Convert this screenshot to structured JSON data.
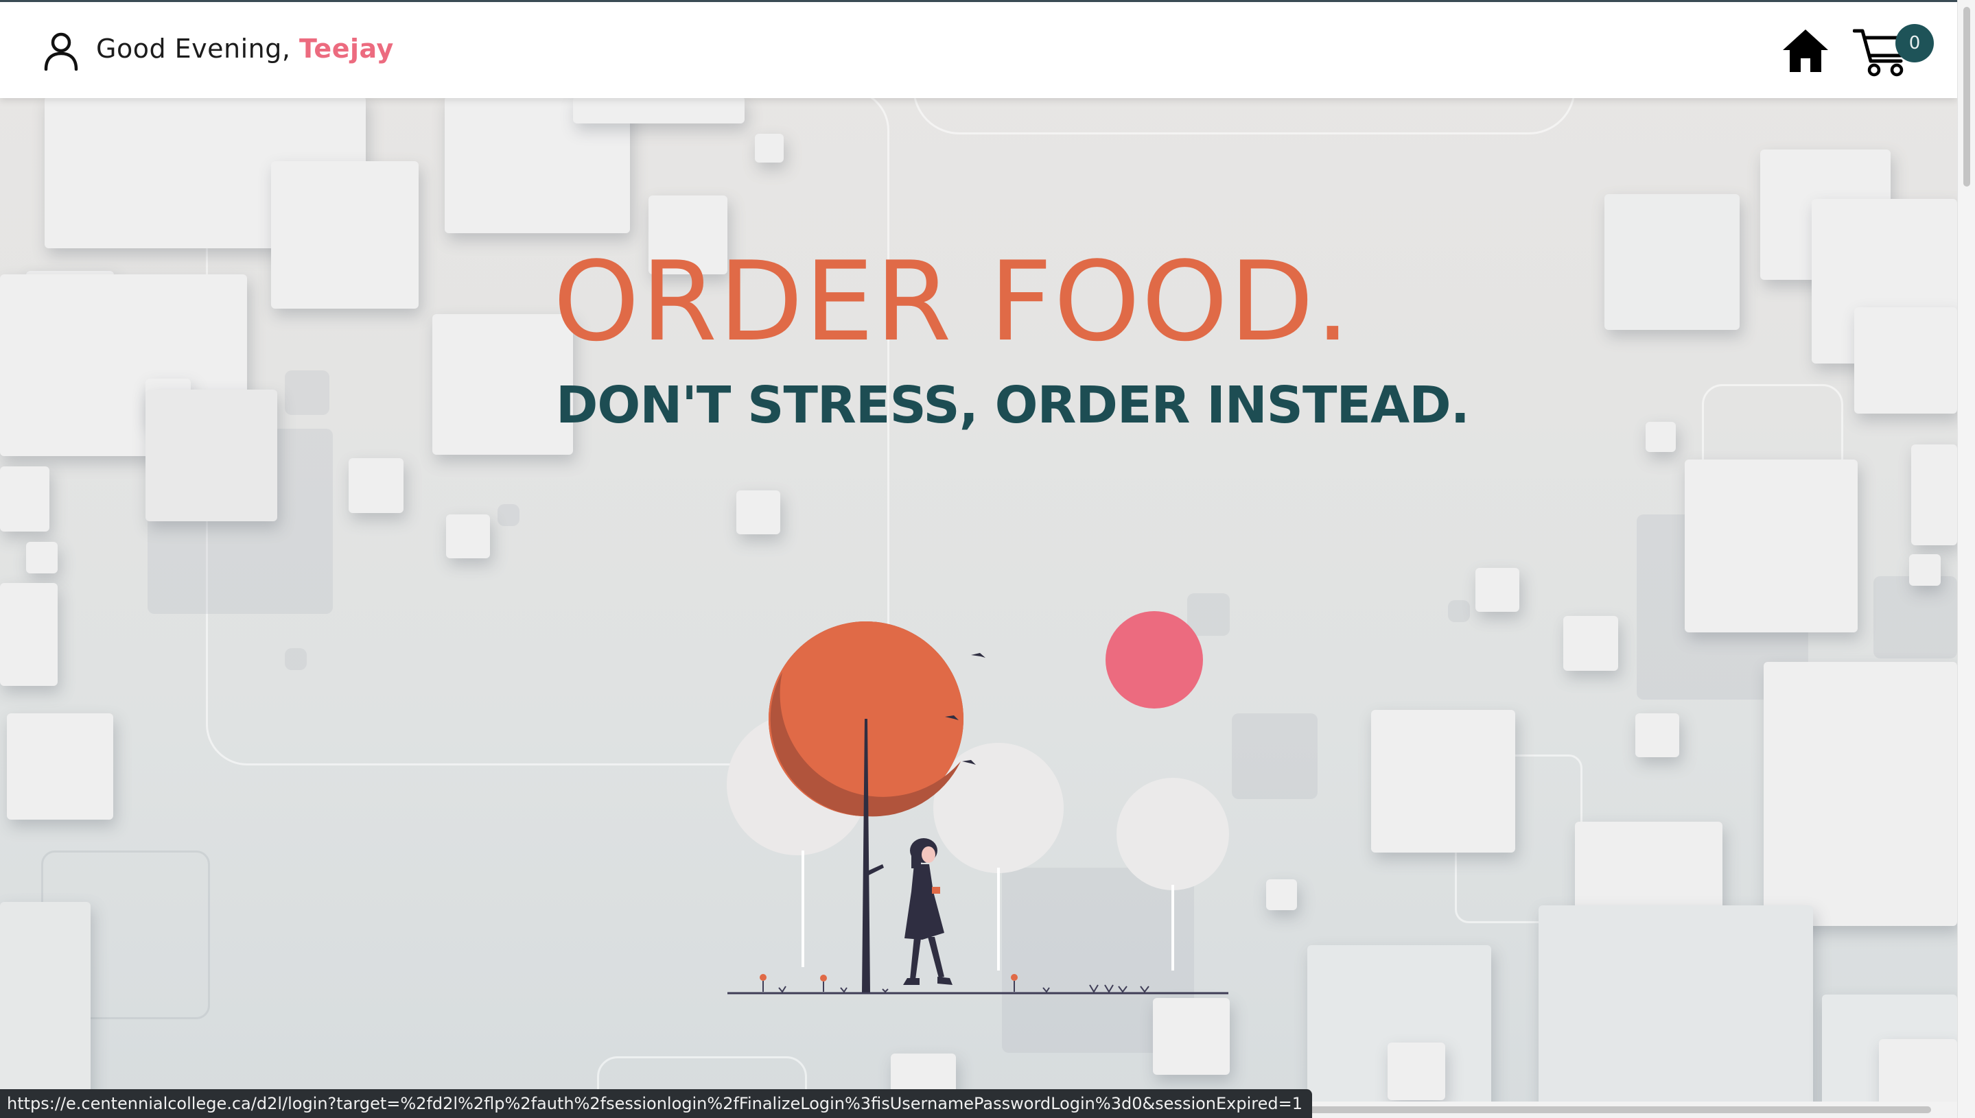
{
  "header": {
    "greeting": "Good Evening,",
    "user_name": "Teejay",
    "cart_count": "0",
    "icons": {
      "user": "user-icon",
      "home": "home-icon",
      "cart": "cart-icon"
    }
  },
  "hero": {
    "title": "ORDER FOOD.",
    "subtitle": "DON'T STRESS, ORDER INSTEAD."
  },
  "status_bar": {
    "url": "https://e.centennialcollege.ca/d2l/login?target=%2fd2l%2flp%2fauth%2fsessionlogin%2fFinalizeLogin%3fisUsernamePasswordLogin%3d0&sessionExpired=1"
  },
  "colors": {
    "accent_orange": "#e06a47",
    "accent_pink": "#ec6b7f",
    "dark_teal": "#1d4d53",
    "badge_teal": "#1e5358"
  }
}
